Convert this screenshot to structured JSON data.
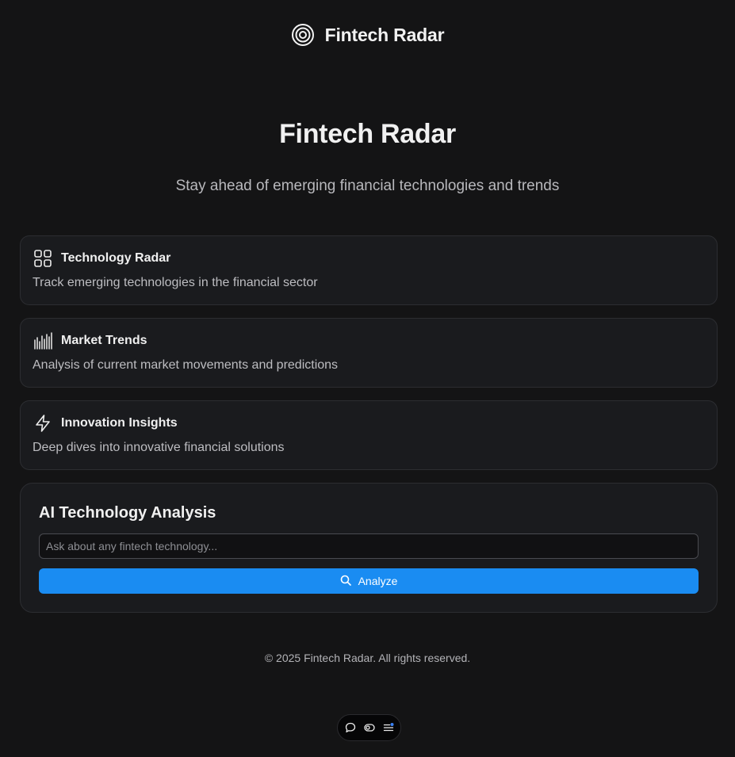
{
  "header": {
    "brand_name": "Fintech Radar",
    "logo_icon": "radar-icon"
  },
  "hero": {
    "title": "Fintech Radar",
    "subtitle": "Stay ahead of emerging financial technologies and trends"
  },
  "features": [
    {
      "icon": "grid-icon",
      "title": "Technology Radar",
      "description": "Track emerging technologies in the financial sector"
    },
    {
      "icon": "bar-chart-icon",
      "title": "Market Trends",
      "description": "Analysis of current market movements and predictions"
    },
    {
      "icon": "lightning-icon",
      "title": "Innovation Insights",
      "description": "Deep dives into innovative financial solutions"
    }
  ],
  "analysis": {
    "title": "AI Technology Analysis",
    "input_placeholder": "Ask about any fintech technology...",
    "input_value": "",
    "button_label": "Analyze",
    "button_icon": "search-icon"
  },
  "footer": {
    "text": "© 2025 Fintech Radar. All rights reserved."
  },
  "dock": {
    "icons": [
      "chat-icon",
      "toggle-icon",
      "menu-icon"
    ]
  },
  "colors": {
    "background": "#141415",
    "card": "#1a1b1e",
    "accent": "#1a8cf2",
    "dock_badge": "#3b82f6"
  }
}
